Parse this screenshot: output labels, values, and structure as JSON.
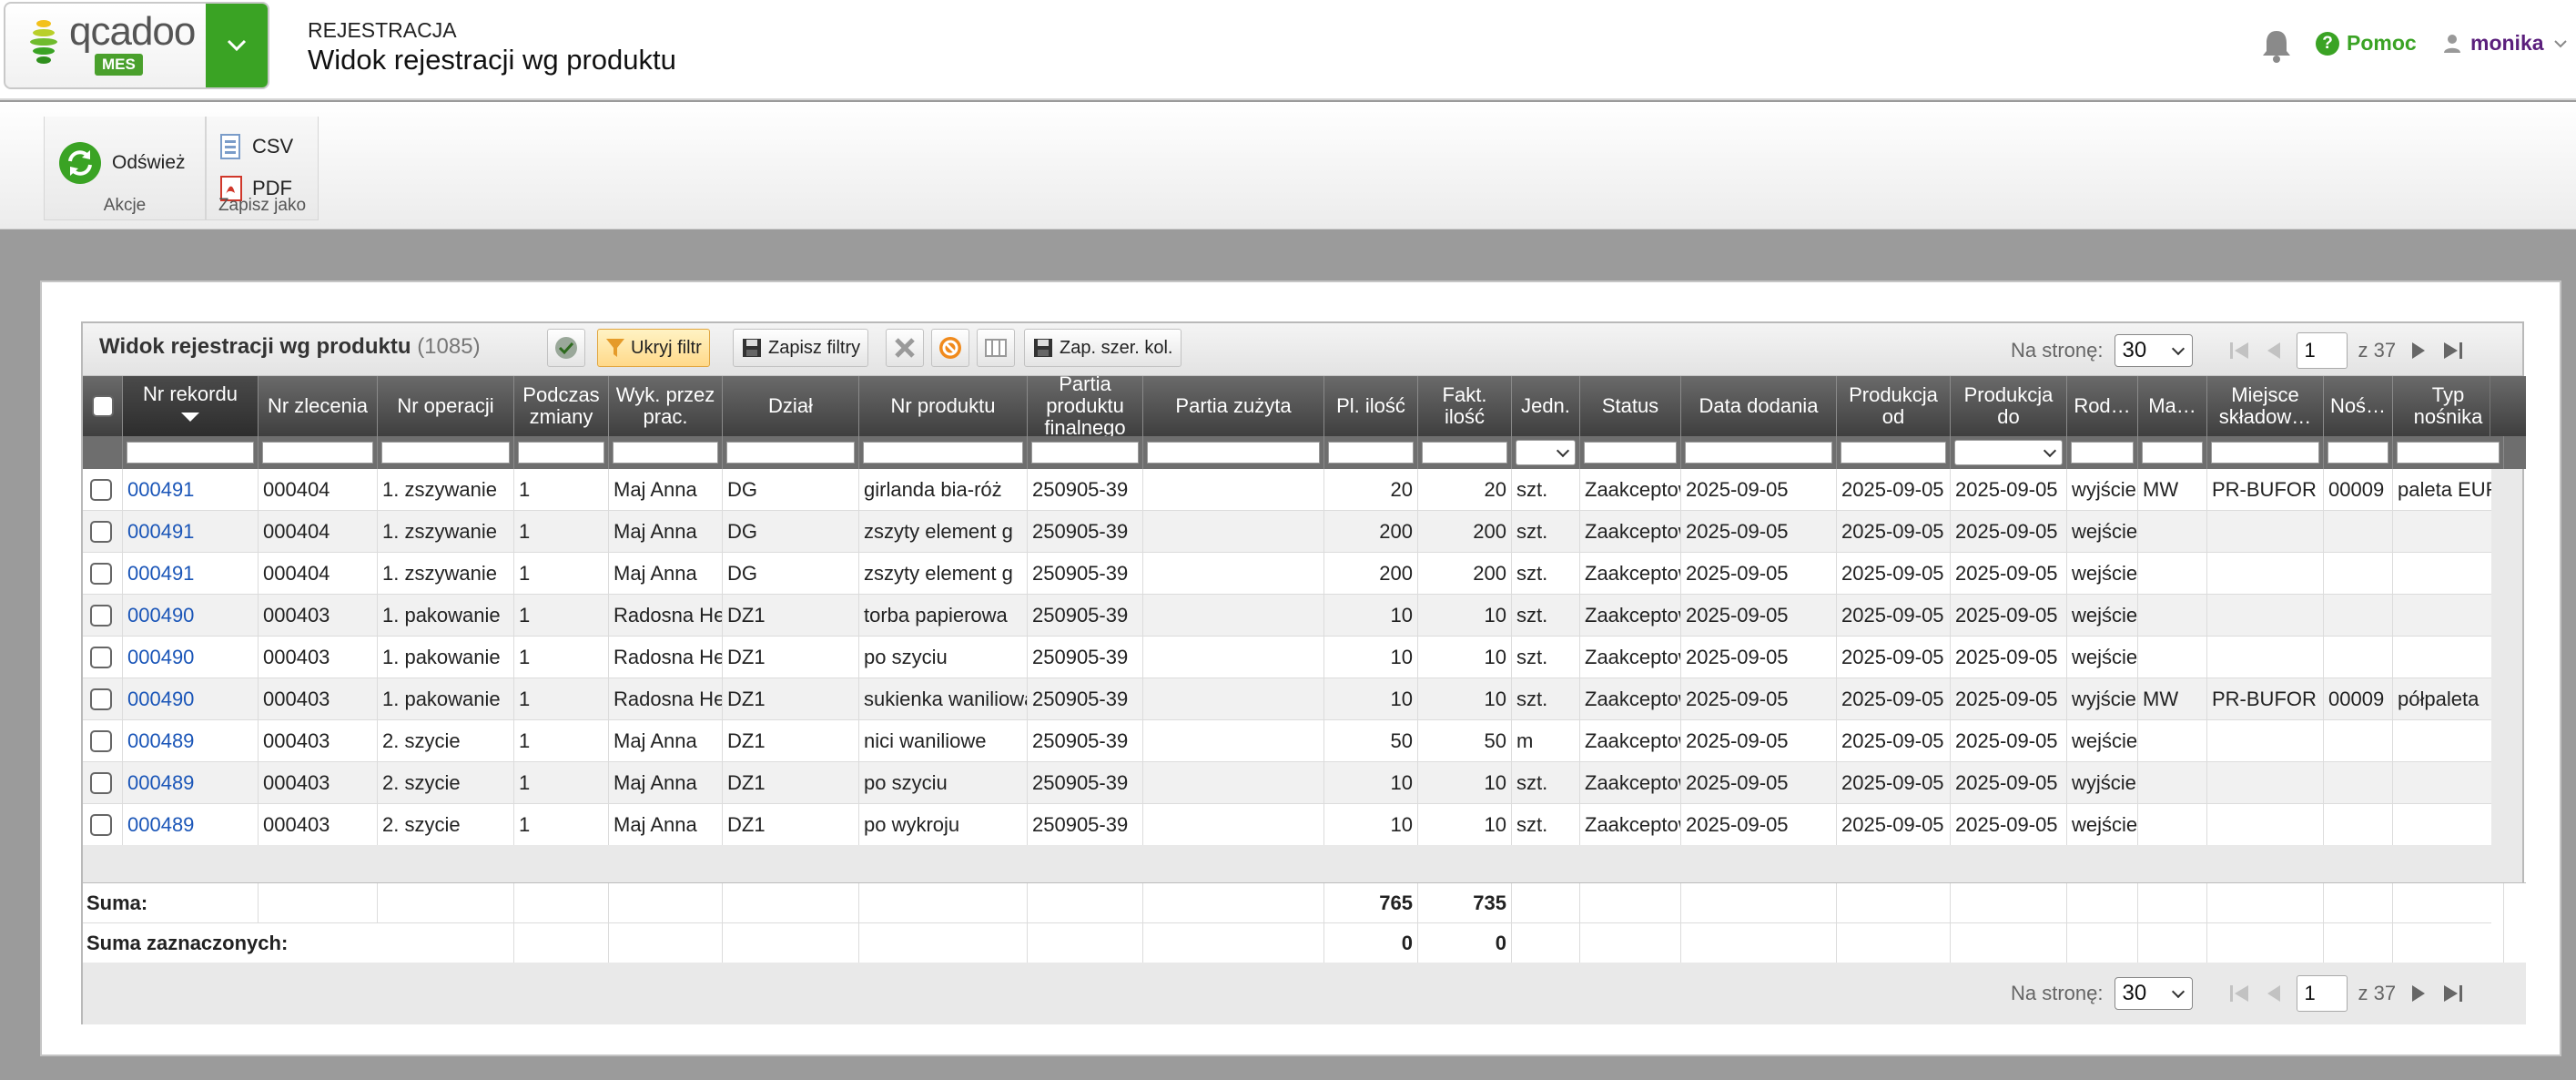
{
  "header": {
    "logo_text": "qcadoo",
    "logo_badge": "MES",
    "kicker": "REJESTRACJA",
    "title": "Widok rejestracji wg produktu",
    "help_label": "Pomoc",
    "user_name": "monika"
  },
  "ribbon": {
    "refresh_label": "Odśwież",
    "actions_group": "Akcje",
    "csv_label": "CSV",
    "pdf_label": "PDF",
    "save_as_group": "Zapisz jako"
  },
  "grid": {
    "title": "Widok rejestracji wg produktu",
    "count": "(1085)",
    "hide_filter": "Ukryj filtr",
    "save_filters": "Zapisz filtry",
    "save_col_width": "Zap. szer. kol.",
    "per_page_label": "Na stronę:",
    "per_page_value": "30",
    "page_value": "1",
    "page_total": "z 37"
  },
  "columns": [
    "Nr rekordu",
    "Nr zlecenia",
    "Nr operacji",
    "Podczas zmiany",
    "Wyk. przez prac.",
    "Dział",
    "Nr produktu",
    "Partia produktu finalnego",
    "Partia zużyta",
    "Pl. ilość",
    "Fakt. ilość",
    "Jedn.",
    "Status",
    "Data dodania",
    "Produkcja od",
    "Produkcja do",
    "Rod…",
    "Ma…",
    "Miejsce składow…",
    "Noś…",
    "Typ nośnika"
  ],
  "rows": [
    [
      "000491",
      "000404",
      "1. zszywanie",
      "1",
      "Maj Anna",
      "DG",
      "girlanda bia-róż",
      "250905-39",
      "",
      "20",
      "20",
      "szt.",
      "Zaakceptowana",
      "2025-09-05",
      "2025-09-05",
      "2025-09-05",
      "wyjście",
      "MW",
      "PR-BUFOR",
      "00009",
      "paleta EURO"
    ],
    [
      "000491",
      "000404",
      "1. zszywanie",
      "1",
      "Maj Anna",
      "DG",
      "zszyty element g",
      "250905-39",
      "",
      "200",
      "200",
      "szt.",
      "Zaakceptowana",
      "2025-09-05",
      "2025-09-05",
      "2025-09-05",
      "wejście",
      "",
      "",
      "",
      ""
    ],
    [
      "000491",
      "000404",
      "1. zszywanie",
      "1",
      "Maj Anna",
      "DG",
      "zszyty element g",
      "250905-39",
      "",
      "200",
      "200",
      "szt.",
      "Zaakceptowana",
      "2025-09-05",
      "2025-09-05",
      "2025-09-05",
      "wejście",
      "",
      "",
      "",
      ""
    ],
    [
      "000490",
      "000403",
      "1. pakowanie",
      "1",
      "Radosna Helena",
      "DZ1",
      "torba papierowa",
      "250905-39",
      "",
      "10",
      "10",
      "szt.",
      "Zaakceptowana",
      "2025-09-05",
      "2025-09-05",
      "2025-09-05",
      "wejście",
      "",
      "",
      "",
      ""
    ],
    [
      "000490",
      "000403",
      "1. pakowanie",
      "1",
      "Radosna Helena",
      "DZ1",
      "po szyciu",
      "250905-39",
      "",
      "10",
      "10",
      "szt.",
      "Zaakceptowana",
      "2025-09-05",
      "2025-09-05",
      "2025-09-05",
      "wejście",
      "",
      "",
      "",
      ""
    ],
    [
      "000490",
      "000403",
      "1. pakowanie",
      "1",
      "Radosna Helena",
      "DZ1",
      "sukienka waniliowa",
      "250905-39",
      "",
      "10",
      "10",
      "szt.",
      "Zaakceptowana",
      "2025-09-05",
      "2025-09-05",
      "2025-09-05",
      "wyjście",
      "MW",
      "PR-BUFOR",
      "00009",
      "półpaleta"
    ],
    [
      "000489",
      "000403",
      "2. szycie",
      "1",
      "Maj Anna",
      "DZ1",
      "nici waniliowe",
      "250905-39",
      "",
      "50",
      "50",
      "m",
      "Zaakceptowana",
      "2025-09-05",
      "2025-09-05",
      "2025-09-05",
      "wejście",
      "",
      "",
      "",
      ""
    ],
    [
      "000489",
      "000403",
      "2. szycie",
      "1",
      "Maj Anna",
      "DZ1",
      "po szyciu",
      "250905-39",
      "",
      "10",
      "10",
      "szt.",
      "Zaakceptowana",
      "2025-09-05",
      "2025-09-05",
      "2025-09-05",
      "wyjście",
      "",
      "",
      "",
      ""
    ],
    [
      "000489",
      "000403",
      "2. szycie",
      "1",
      "Maj Anna",
      "DZ1",
      "po wykroju",
      "250905-39",
      "",
      "10",
      "10",
      "szt.",
      "Zaakceptowana",
      "2025-09-05",
      "2025-09-05",
      "2025-09-05",
      "wejście",
      "",
      "",
      "",
      ""
    ]
  ],
  "footer": {
    "sum_label": "Suma:",
    "sum_planned": "765",
    "sum_actual": "735",
    "selected_label": "Suma zaznaczonych:",
    "selected_planned": "0",
    "selected_actual": "0"
  },
  "colors": {
    "brand_green": "#3aa324",
    "link_blue": "#1b56b8",
    "user_purple": "#5b1f7c"
  }
}
